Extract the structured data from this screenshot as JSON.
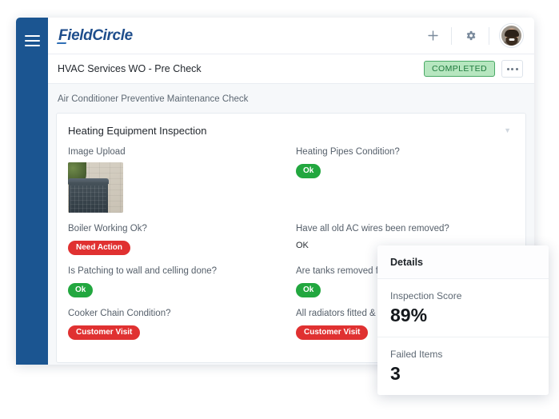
{
  "sidebar": {
    "menu_icon": "hamburger-icon"
  },
  "topbar": {
    "logo_text": "FieldCircle",
    "add_icon": "plus-icon",
    "settings_icon": "gear-icon",
    "avatar": "user-avatar"
  },
  "titlebar": {
    "work_order_title": "HVAC Services WO - Pre Check",
    "status_badge": "COMPLETED",
    "more_menu_icon": "ellipsis-icon"
  },
  "content": {
    "subtitle": "Air Conditioner Preventive Maintenance Check",
    "section_title": "Heating Equipment Inspection",
    "collapse_icon": "chevron-down-icon",
    "fields": [
      {
        "label": "Image Upload",
        "type": "image",
        "image_alt": "air-conditioner-unit-photo"
      },
      {
        "label": "Heating Pipes Condition?",
        "type": "pill",
        "value": "Ok",
        "style": "ok"
      },
      {
        "label": "Boiler Working Ok?",
        "type": "pill",
        "value": "Need Action",
        "style": "danger"
      },
      {
        "label": "Have all old AC wires been removed?",
        "type": "text",
        "value": "OK"
      },
      {
        "label": "Is Patching to wall and celling done?",
        "type": "pill",
        "value": "Ok",
        "style": "ok"
      },
      {
        "label": "Are tanks removed fro",
        "type": "pill",
        "value": "Ok",
        "style": "ok"
      },
      {
        "label": "Cooker Chain Condition?",
        "type": "pill",
        "value": "Customer Visit",
        "style": "danger"
      },
      {
        "label": "All radiators fitted &",
        "type": "pill",
        "value": "Customer Visit",
        "style": "danger"
      }
    ]
  },
  "details": {
    "title": "Details",
    "rows": [
      {
        "label": "Inspection Score",
        "value": "89%"
      },
      {
        "label": "Failed Items",
        "value": "3"
      }
    ]
  },
  "colors": {
    "sidebar_blue": "#1b5591",
    "logo_blue": "#1f4e8c",
    "status_green_bg": "#b6e6bf",
    "status_green_text": "#1f7a3d",
    "pill_green": "#22a73f",
    "pill_red": "#e03131",
    "page_bg": "#f6f8fa"
  }
}
